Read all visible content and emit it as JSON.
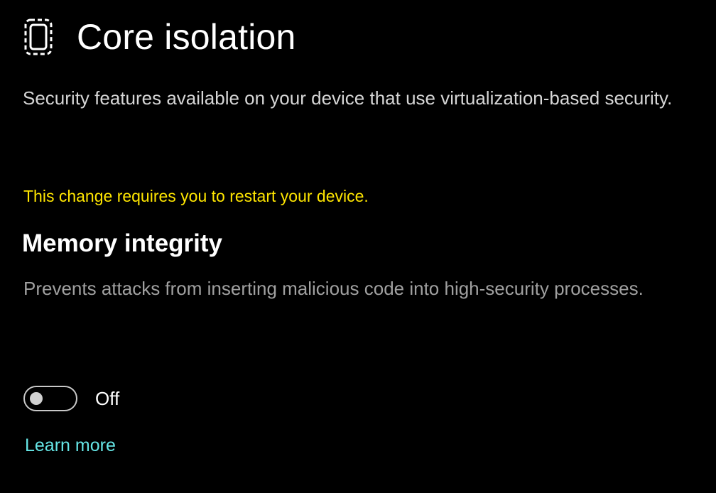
{
  "header": {
    "icon": "core-isolation-chip-icon",
    "title": "Core isolation"
  },
  "description": "Security features available on your device that use virtualization-based security.",
  "warning": {
    "text": "This change requires you to restart your device.",
    "color": "#ffe600"
  },
  "memory_integrity": {
    "title": "Memory integrity",
    "description": "Prevents attacks from inserting malicious code into high-security processes.",
    "toggle": {
      "state": "off",
      "label": "Off"
    }
  },
  "learn_more": {
    "label": "Learn more",
    "color": "#66e6e6"
  },
  "colors": {
    "background": "#000000",
    "text": "#ffffff",
    "secondary_text": "#a0a0a0"
  }
}
